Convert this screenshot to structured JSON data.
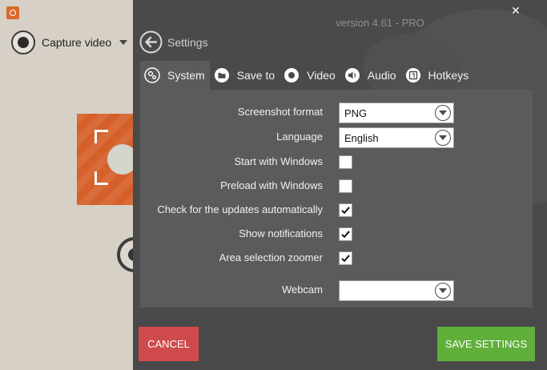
{
  "background_app": {
    "capture_label": "Capture video",
    "accent_color": "#d5602a"
  },
  "header": {
    "version": "version 4.61 - PRO",
    "close_glyph": "✕",
    "back_label": "Settings"
  },
  "tabs": [
    {
      "label": "System",
      "icon": "gears-icon",
      "active": true
    },
    {
      "label": "Save to",
      "icon": "folder-icon",
      "active": false
    },
    {
      "label": "Video",
      "icon": "record-icon",
      "active": false
    },
    {
      "label": "Audio",
      "icon": "speaker-icon",
      "active": false
    },
    {
      "label": "Hotkeys",
      "icon": "keyboard-key-icon",
      "active": false
    }
  ],
  "system": {
    "screenshot_format": {
      "label": "Screenshot format",
      "value": "PNG"
    },
    "language": {
      "label": "Language",
      "value": "English"
    },
    "start_with_windows": {
      "label": "Start with Windows",
      "checked": false
    },
    "preload_with_windows": {
      "label": "Preload with Windows",
      "checked": false
    },
    "check_updates": {
      "label": "Check for the updates automatically",
      "checked": true
    },
    "show_notifications": {
      "label": "Show notifications",
      "checked": true
    },
    "area_selection_zoomer": {
      "label": "Area selection zoomer",
      "checked": true
    },
    "webcam": {
      "label": "Webcam",
      "value": ""
    }
  },
  "footer": {
    "cancel_label": "CANCEL",
    "save_label": "SAVE SETTINGS",
    "cancel_color": "#cf4a4a",
    "save_color": "#5faf3a"
  }
}
